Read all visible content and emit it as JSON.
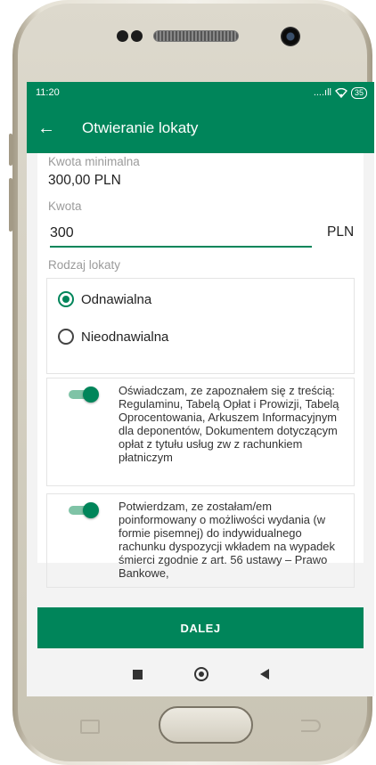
{
  "status_bar": {
    "time": "11:20",
    "signal": "....ıll",
    "battery": "35"
  },
  "app_bar": {
    "title": "Otwieranie lokaty"
  },
  "form": {
    "min_amount_label": "Kwota minimalna",
    "min_amount_value": "300,00 PLN",
    "amount_label": "Kwota",
    "amount_value": "300",
    "currency": "PLN",
    "deposit_type_label": "Rodzaj lokaty",
    "options": [
      {
        "label": "Odnawialna",
        "selected": true
      },
      {
        "label": "Nieodnawialna",
        "selected": false
      }
    ]
  },
  "consents": [
    {
      "text": "Oświadczam, ze zapoznałem się z treścią: Regulaminu, Tabelą Opłat i Prowizji, Tabelą Oprocentowania, Arkuszem Informacyjnym dla deponentów, Dokumentem dotyczącym opłat z tytułu usług zw z rachunkiem płatniczym",
      "enabled": true
    },
    {
      "text": "Potwierdzam, ze zostałam/em poinformowany o możliwości wydania (w formie pisemnej) do indywidualnego rachunku dyspozycji wkładem na wypadek śmierci zgodnie z  art. 56 ustawy – Prawo Bankowe,",
      "enabled": true
    }
  ],
  "primary_button": "DALEJ",
  "colors": {
    "brand": "#00855a",
    "toggle_track": "#7fc3a6"
  }
}
